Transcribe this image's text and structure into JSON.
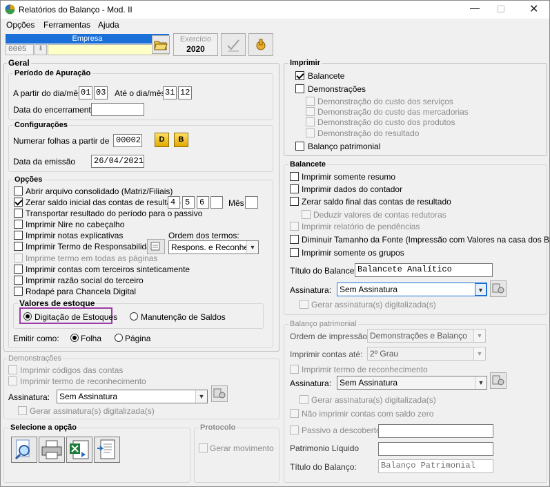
{
  "window": {
    "title": "Relatórios do Balanço - Mod. II"
  },
  "menu": [
    "Opções",
    "Ferramentas",
    "Ajuda"
  ],
  "toolbar": {
    "empresa_label": "Empresa",
    "empresa_code": "0005",
    "exercicio_label": "Exercício",
    "exercicio_value": "2020"
  },
  "geral": {
    "title": "Geral"
  },
  "periodo": {
    "title": "Período de Apuração",
    "a_partir": "A partir do dia/mês",
    "from_day": "01",
    "from_month": "03",
    "ate": "Até o dia/mês",
    "to_day": "31",
    "to_month": "12",
    "encerramento": "Data do encerramento",
    "encerramento_value": ""
  },
  "config": {
    "title": "Configurações",
    "numerar": "Numerar folhas a partir de",
    "numerar_value": "00002",
    "btn_d": "D",
    "btn_b": "B",
    "emissao": "Data da emissão",
    "emissao_value": "26/04/2021"
  },
  "opcoes": {
    "title": "Opções",
    "items": [
      "Abrir arquivo consolidado (Matriz/Filiais)",
      "Zerar saldo inicial das contas de resultado",
      "Transportar resultado do período para o passivo",
      "Imprimir Nire no cabeçalho",
      "Imprimir notas explicativas",
      "Imprimir Termo de Responsabilidade",
      "Imprime termo em todas as páginas",
      "Imprimir contas com terceiros sinteticamente",
      "Imprimir razão social do terceiro",
      "Rodapé para Chancela Digital"
    ],
    "zerar_v1": "4",
    "zerar_v2": "5",
    "zerar_v3": "6",
    "zerar_v4": "",
    "mes_label": "Mês",
    "mes_value": "",
    "ordem_label": "Ordem dos termos:",
    "ordem_value": "Respons. e Reconhec.",
    "valores_title": "Valores de estoque",
    "digitacao": "Digitação de Estoques",
    "manutencao": "Manutenção de Saldos",
    "emitir": "Emitir como:",
    "folha": "Folha",
    "pagina": "Página"
  },
  "demonstracoes": {
    "title": "Demonstrações",
    "item1": "Imprimir códigos das contas",
    "item2": "Imprimir termo de reconhecimento",
    "assinatura_label": "Assinatura:",
    "assinatura_value": "Sem Assinatura",
    "gerar": "Gerar assinatura(s) digitalizada(s)"
  },
  "selecione": {
    "title": "Selecione a opção"
  },
  "protocolo": {
    "title": "Protocolo",
    "gerar": "Gerar movimento"
  },
  "imprimir": {
    "title": "Imprimir",
    "balancete": "Balancete",
    "demonstracoes": "Demonstrações",
    "sub": [
      "Demonstração do custo dos serviços",
      "Demonstração do custo das mercadorias",
      "Demonstração do custo dos produtos",
      "Demonstração do resultado"
    ],
    "balanco": "Balanço patrimonial"
  },
  "balancete": {
    "title": "Balancete",
    "items": [
      "Imprimir somente resumo",
      "Imprimir dados do contador",
      "Zerar saldo final das contas de resultado",
      "Deduzir valores de contas redutoras",
      "Imprimir relatório de pendências",
      "Diminuir Tamanho da Fonte (Impressão com Valores na casa dos Bilhões)",
      "Imprimir somente os grupos"
    ],
    "titulo_label": "Título do Balancete:",
    "titulo_value": "Balancete Analítico",
    "assinatura_label": "Assinatura:",
    "assinatura_value": "Sem Assinatura",
    "gerar": "Gerar assinatura(s) digitalizada(s)"
  },
  "balanco": {
    "title": "Balanço patrimonial",
    "ordem_label": "Ordem de impressão:",
    "ordem_value": "Demonstrações e Balanço",
    "contas_label": "Imprimir contas até:",
    "contas_value": "2º Grau",
    "termo": "Imprimir termo de reconhecimento",
    "assinatura_label": "Assinatura:",
    "assinatura_value": "Sem Assinatura",
    "gerar": "Gerar assinatura(s) digitalizada(s)",
    "nao_imprimir": "Não imprimir contas com saldo zero",
    "passivo": "Passivo a descoberto",
    "passivo_value": "",
    "pl_label": "Patrimonio Líquido",
    "pl_value": "",
    "titulo_label": "Título do Balanço:",
    "titulo_value": "Balanço Patrimonial"
  }
}
